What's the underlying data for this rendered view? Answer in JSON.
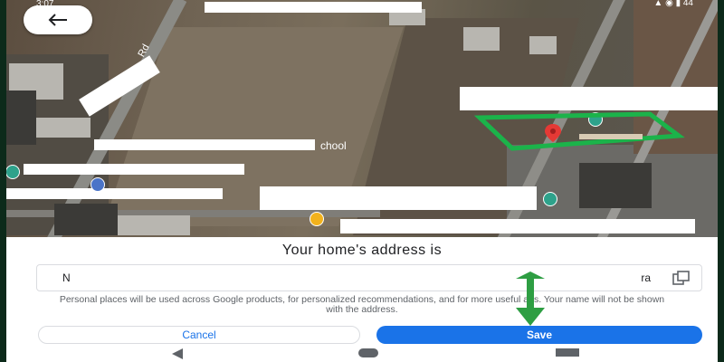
{
  "status_bar": {
    "time": "3:07",
    "right": "▲ ◉ ▮ 44"
  },
  "map": {
    "road_label": "Rd",
    "school_label": "chool",
    "colors": {
      "outline": "#1bb34a",
      "pin": "#e53935"
    }
  },
  "back_button": {
    "icon": "arrow-left-icon"
  },
  "sheet": {
    "title": "Your home's address is",
    "address_start": "N",
    "address_end": "ra",
    "copy_icon": "copy-icon",
    "disclaimer": "Personal places will be used across Google products, for personalized recommendations, and for more useful ads. Your name will not be shown with the address.",
    "cancel_label": "Cancel",
    "save_label": "Save",
    "accent": "#1a73e8"
  },
  "nav": {
    "back_icon": "nav-back-icon",
    "home_icon": "nav-home-icon",
    "recent_icon": "nav-recents-icon"
  }
}
